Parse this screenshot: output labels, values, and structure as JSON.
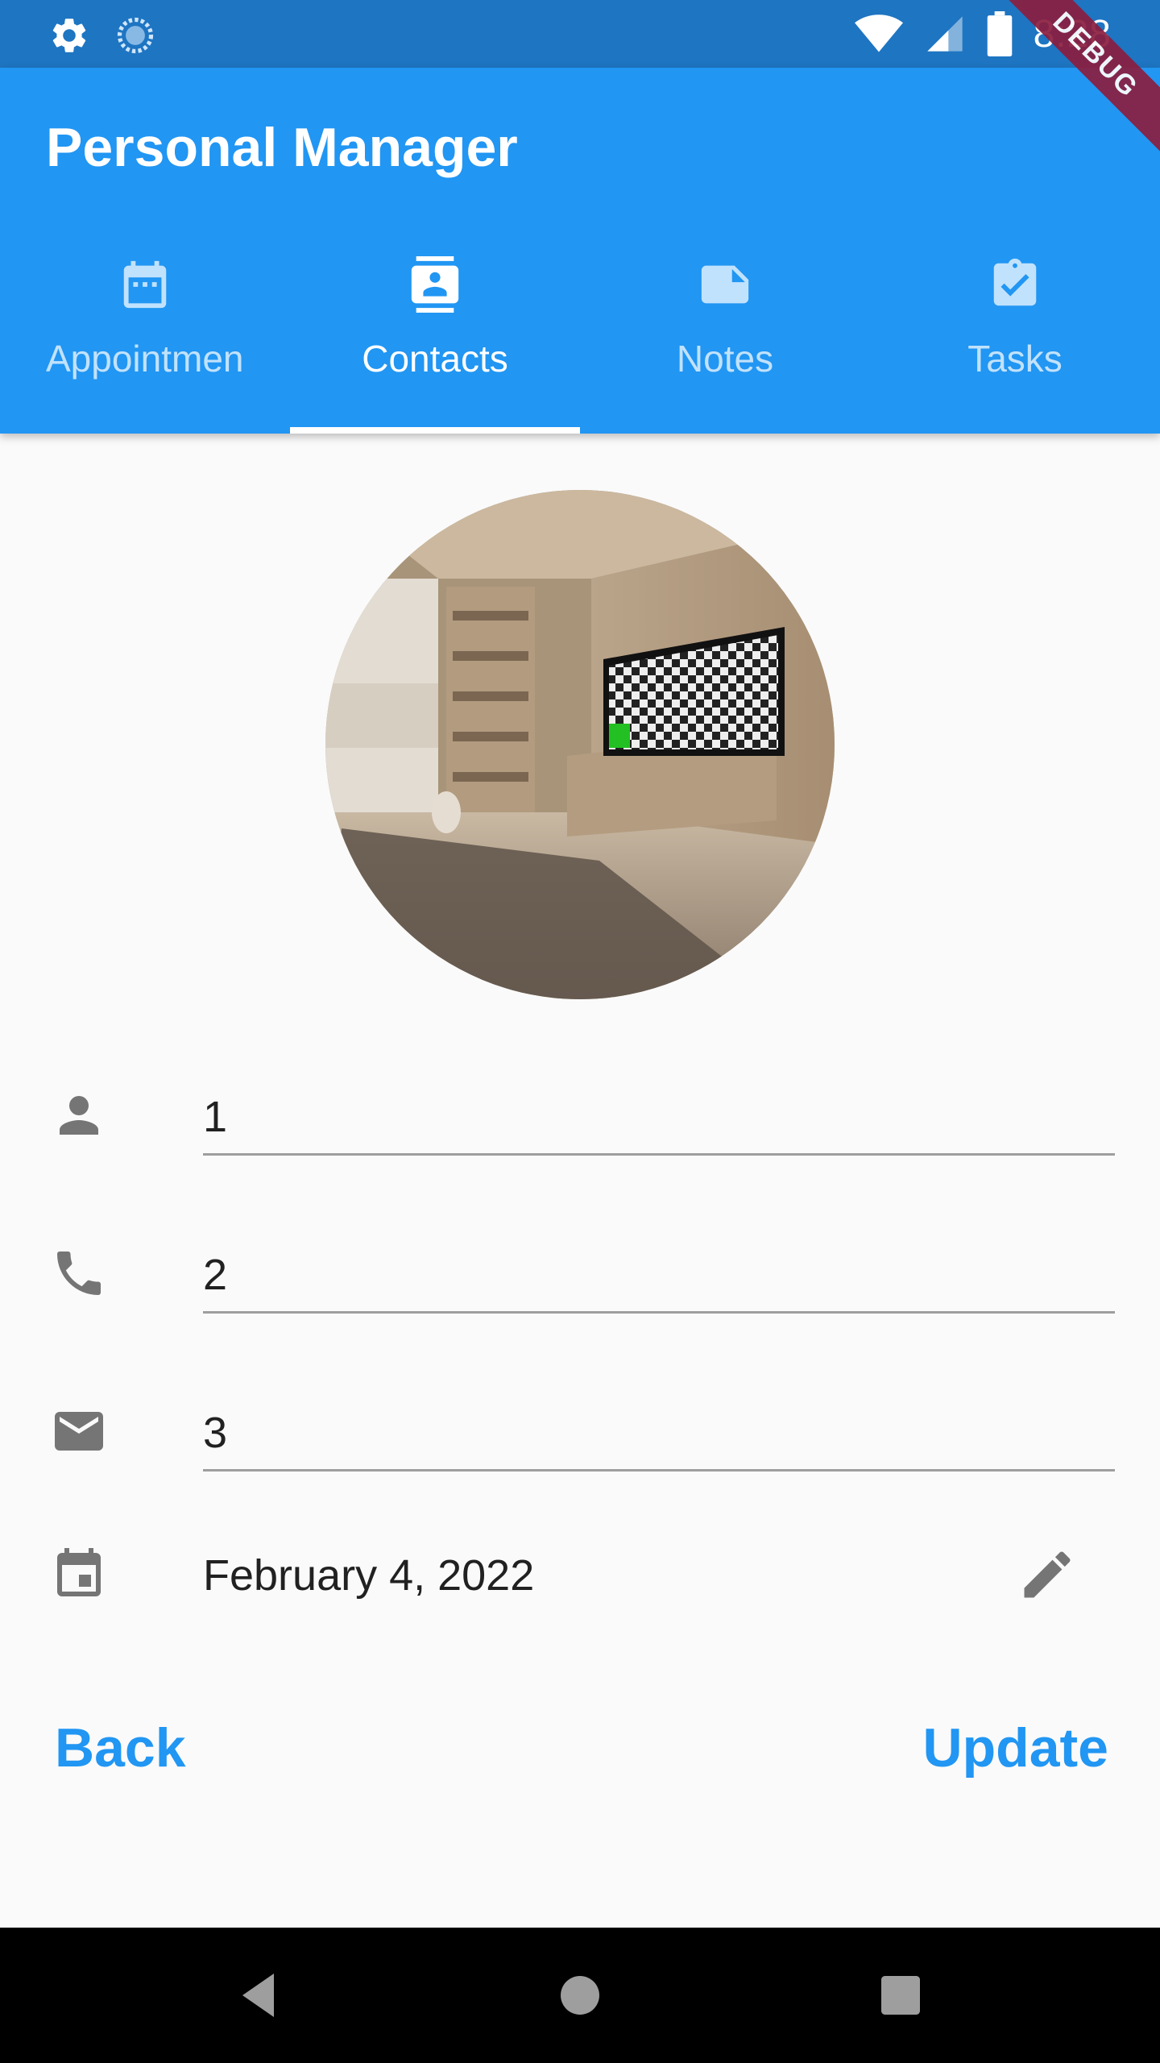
{
  "status_bar": {
    "time": "8:28",
    "left_icons": [
      "gear-icon",
      "sync-icon"
    ],
    "right_icons": [
      "wifi-icon",
      "signal-icon",
      "battery-icon"
    ]
  },
  "debug_banner": "DEBUG",
  "app_bar": {
    "title": "Personal Manager",
    "color": "#2196f3"
  },
  "tabs": [
    {
      "label": "Appointments",
      "icon": "calendar-icon"
    },
    {
      "label": "Contacts",
      "icon": "contacts-icon",
      "active": true
    },
    {
      "label": "Notes",
      "icon": "note-icon"
    },
    {
      "label": "Tasks",
      "icon": "assignment-check-icon"
    }
  ],
  "contact": {
    "avatar": "room-photo",
    "name_value": "1",
    "phone_value": "2",
    "email_value": "3",
    "birthday": "February 4, 2022"
  },
  "actions": {
    "back_label": "Back",
    "update_label": "Update"
  },
  "colors": {
    "accent": "#2196f3",
    "status_bar": "#1e75c2",
    "debug": "#8b1e3f"
  }
}
